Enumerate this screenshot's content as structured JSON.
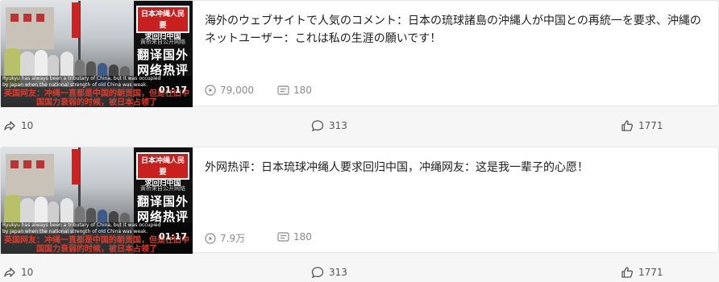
{
  "posts": [
    {
      "title": "海外のウェブサイトで人気のコメント：日本の琉球諸島の沖縄人が中国との再統一を要求、沖縄のネットユーザー：これは私の生涯の願いです！",
      "views": "79,000",
      "comments_count": "180",
      "thumb": {
        "badge_line1": "日本冲绳人民要",
        "badge_line2": "求回归中国",
        "tagline": "黄桥来自公开网络",
        "big_line1": "翻译国外",
        "big_line2": "网络热评",
        "duration": "01:17",
        "subtitle_en": "Ryukyu has always been a tributary of China, but it was occupied by Japan when the national strength of old China was weak.",
        "subtitle_zh": "英国网友：冲绳一直都是中国的朝贡国，但是在旧中国国力衰弱的时候，被日本占领了"
      },
      "actions": {
        "share": "10",
        "comment": "313",
        "like": "1771"
      }
    },
    {
      "title": "外网热评：日本琉球冲绳人要求回归中国，冲绳网友：这是我一辈子的心愿！",
      "views": "7.9万",
      "comments_count": "180",
      "thumb": {
        "badge_line1": "日本冲绳人民要",
        "badge_line2": "求回归中国",
        "tagline": "黄桥来自公开网络",
        "big_line1": "翻译国外",
        "big_line2": "网络热评",
        "duration": "01:17",
        "subtitle_en": "Ryukyu has always been a tributary of China, but it was occupied by Japan when the national strength of old China was weak.",
        "subtitle_zh": "英国网友：冲绳一直都是中国的朝贡国，但是在旧中国国力衰弱的时候，被日本占领了"
      },
      "actions": {
        "share": "10",
        "comment": "313",
        "like": "1771"
      }
    }
  ],
  "icons": {
    "views": "play-count-icon",
    "comments": "danmaku-icon",
    "share": "share-icon",
    "comment": "comment-icon",
    "like": "thumbs-up-icon"
  },
  "colors": {
    "subtitle_red": "#e23a2a",
    "badge_red": "#c81f1f",
    "meta_gray": "#8b8b8f"
  }
}
